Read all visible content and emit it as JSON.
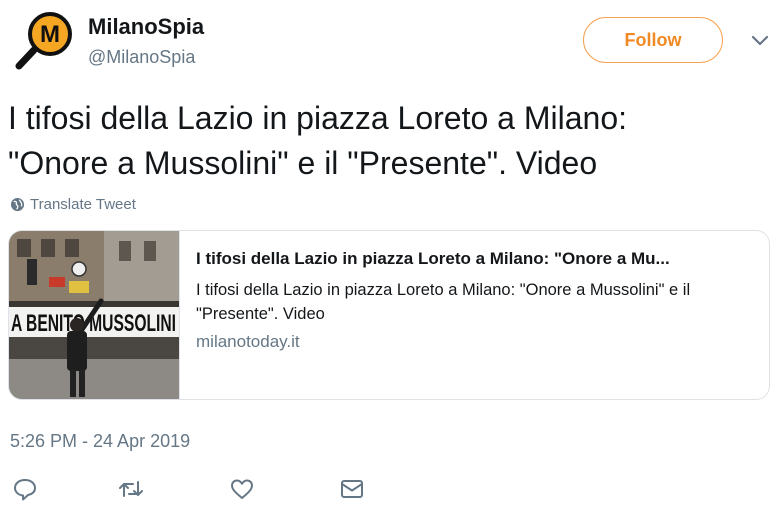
{
  "user": {
    "display_name": "MilanoSpia",
    "handle": "@MilanoSpia",
    "avatar_letter": "M",
    "avatar_color": "#f5a623"
  },
  "follow_label": "Follow",
  "tweet_text": "I tifosi della Lazio in piazza Loreto a Milano:\n\"Onore a Mussolini\" e il \"Presente\". Video",
  "translate_label": "Translate Tweet",
  "card": {
    "title": "I tifosi della Lazio in piazza Loreto a Milano: \"Onore a Mu...",
    "description": "I tifosi della Lazio in piazza Loreto a Milano: \"Onore a Mussolini\" e il \"Presente\". Video",
    "domain": "milanotoday.it",
    "banner_text": "A BENITO MUSSOLINI"
  },
  "timestamp": "5:26 PM - 24 Apr 2019",
  "actions": [
    "reply-icon",
    "retweet-icon",
    "like-icon",
    "message-icon"
  ],
  "colors": {
    "accent": "#f08a24",
    "secondary_text": "#657786",
    "icon": "#657786"
  }
}
